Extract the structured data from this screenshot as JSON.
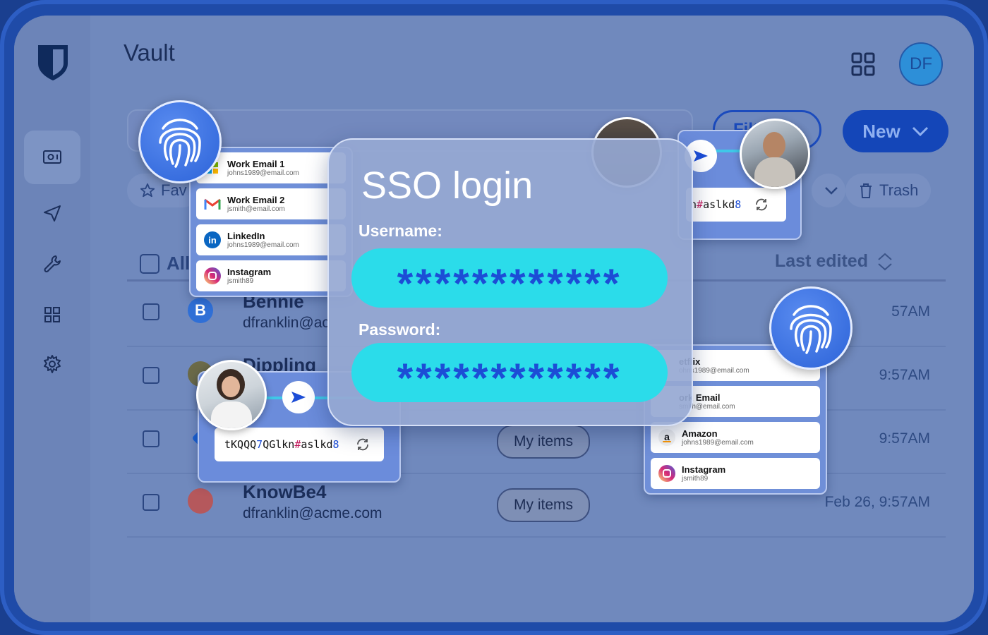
{
  "app": {
    "title": "Vault",
    "avatar_initials": "DF"
  },
  "toolbar": {
    "filter_label": "Filter",
    "new_label": "New"
  },
  "chips": {
    "favorites": "Fav",
    "trash": "Trash"
  },
  "table": {
    "select_all_label": "All",
    "last_edited_header": "Last edited",
    "rows": [
      {
        "name": "Bennie",
        "username": "dfranklin@ac",
        "owner": "",
        "date": "57AM"
      },
      {
        "name": "Dippling",
        "username": "",
        "owner": "",
        "date": "9:57AM"
      },
      {
        "name": "",
        "username": "",
        "owner": "My items",
        "date": "9:57AM"
      },
      {
        "name": "KnowBe4",
        "username": "dfranklin@acme.com",
        "owner": "My items",
        "date": "Feb 26, 9:57AM"
      }
    ]
  },
  "left_list": [
    {
      "title": "Work Email 1",
      "sub": "johns1989@email.com",
      "icon": "microsoft-icon"
    },
    {
      "title": "Work Email 2",
      "sub": "jsmith@email.com",
      "icon": "gmail-icon"
    },
    {
      "title": "LinkedIn",
      "sub": "johns1989@email.com",
      "icon": "linkedin-icon"
    },
    {
      "title": "Instagram",
      "sub": "jsmith89",
      "icon": "instagram-icon"
    }
  ],
  "right_list": [
    {
      "title": "etflix",
      "sub": "ohns1989@email.com",
      "icon": "netflix-icon"
    },
    {
      "title": "ork Email",
      "sub": "smith@email.com",
      "icon": "email-icon"
    },
    {
      "title": "Amazon",
      "sub": "johns1989@email.com",
      "icon": "amazon-icon"
    },
    {
      "title": "Instagram",
      "sub": "jsmith89",
      "icon": "instagram-icon"
    }
  ],
  "generator_left": {
    "pw_a": "tKQQQ",
    "pw_b": "7",
    "pw_c": "QGlkn",
    "pw_d": "#",
    "pw_e": "aslkd",
    "pw_f": "8"
  },
  "generator_right": {
    "pw_a": "n",
    "pw_b": "#",
    "pw_c": "aslkd",
    "pw_d": "8"
  },
  "sso": {
    "title": "SSO login",
    "username_label": "Username:",
    "username_value": "************",
    "password_label": "Password:",
    "password_value": "************"
  },
  "colors": {
    "accent": "#1446b8",
    "field": "#2bdcea",
    "field_text": "#1c4dd6"
  }
}
